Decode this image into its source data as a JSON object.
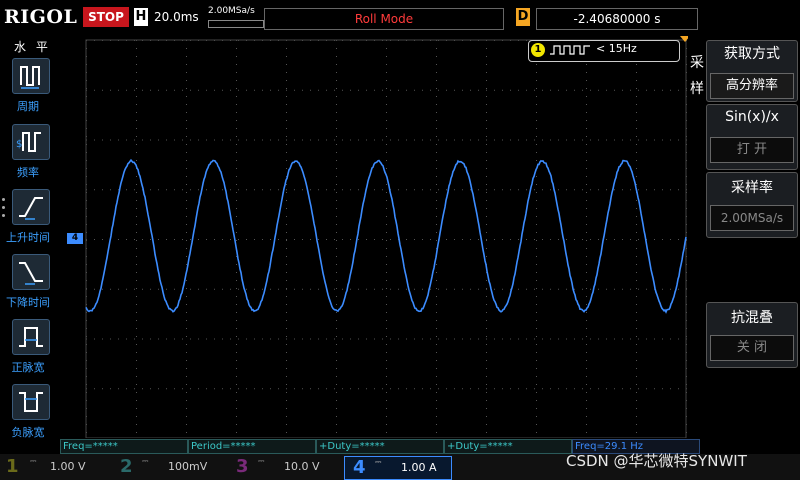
{
  "top": {
    "logo": "RIGOL",
    "run_state": "STOP",
    "timebase_tag": "H",
    "timebase_value": "20.0ms",
    "sample_rate": "2.00MSa/s",
    "mode": "Roll Mode",
    "delay_tag": "D",
    "delay_value": "-2.40680000 s"
  },
  "left_menu": {
    "title": "水 平",
    "items": [
      {
        "label": "周期"
      },
      {
        "label": "频率"
      },
      {
        "label": "上升时间"
      },
      {
        "label": "下降时间"
      },
      {
        "label": "正脉宽"
      },
      {
        "label": "负脉宽"
      }
    ]
  },
  "plot": {
    "trigger_channel": "1",
    "trigger_text": "< 15Hz",
    "channel_marker": "4",
    "waveform": {
      "color": "#3c8cff",
      "cycles": 7.3
    }
  },
  "right_menu": {
    "title": "采样",
    "groups": [
      {
        "title": "获取方式",
        "value": "高分辨率"
      },
      {
        "title": "Sin(x)/x",
        "value": "打 开"
      },
      {
        "title": "采样率",
        "value": "2.00MSa/s"
      },
      {
        "title": "抗混叠",
        "value": "关 闭"
      }
    ]
  },
  "measurements": [
    "Freq=*****",
    "Period=*****",
    "+Duty=*****",
    "+Duty=*****",
    "Freq=29.1 Hz"
  ],
  "channels": [
    {
      "num": "1",
      "scale": "1.00 V",
      "color": "#f2e600"
    },
    {
      "num": "2",
      "scale": "100mV",
      "color": "#00e0e0"
    },
    {
      "num": "3",
      "scale": "10.0 V",
      "color": "#e040e0"
    },
    {
      "num": "4",
      "scale": "1.00 A",
      "color": "#3c8cff"
    }
  ],
  "watermark": "CSDN @华芯微特SYNWIT"
}
